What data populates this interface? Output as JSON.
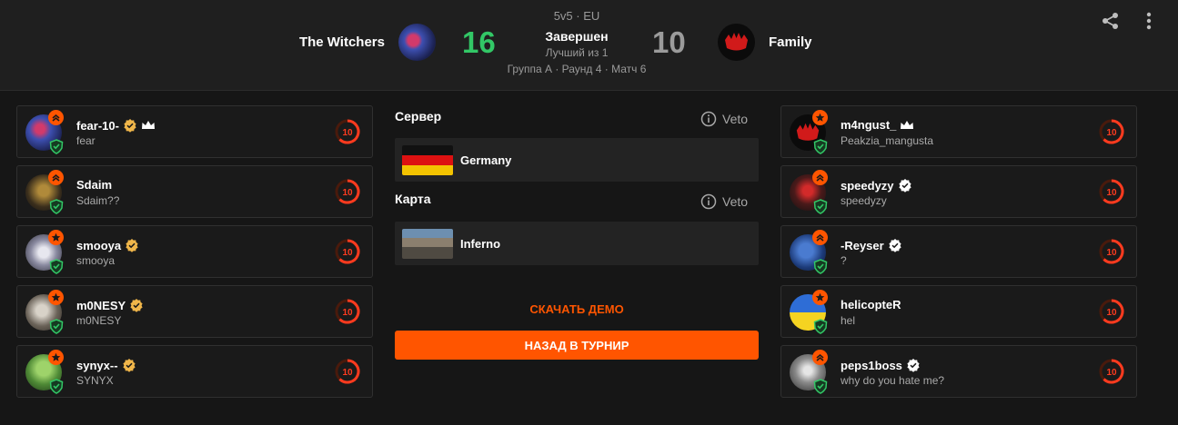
{
  "match": {
    "mode": "5v5 · EU",
    "status": "Завершен",
    "best_of": "Лучший из 1",
    "group_info": "Группа А · Раунд 4 · Матч 6"
  },
  "team_left": {
    "name": "The Witchers",
    "score": "16",
    "score_color": "#32c766"
  },
  "team_right": {
    "name": "Family",
    "score": "10",
    "score_color": "#9b9b9b"
  },
  "header_icons": [
    "share-icon",
    "more-vertical-icon"
  ],
  "left_players": [
    {
      "name": "fear-10-",
      "nick": "fear",
      "verified": true,
      "crown": true,
      "rank": "chevrons",
      "level": "10"
    },
    {
      "name": "Sdaim",
      "nick": "Sdaim??",
      "verified": false,
      "crown": false,
      "rank": "chevrons",
      "level": "10"
    },
    {
      "name": "smooya",
      "nick": "smooya",
      "verified": true,
      "crown": false,
      "rank": "star",
      "level": "10"
    },
    {
      "name": "m0NESY",
      "nick": "m0NESY",
      "verified": true,
      "crown": false,
      "rank": "star",
      "level": "10"
    },
    {
      "name": "synyx--",
      "nick": "SYNYX",
      "verified": true,
      "crown": false,
      "rank": "star",
      "level": "10"
    }
  ],
  "right_players": [
    {
      "name": "m4ngust_",
      "nick": "Peakzia_mangusta",
      "verified": false,
      "crown": true,
      "rank": "star",
      "level": "10"
    },
    {
      "name": "speedyzy",
      "nick": "speedyzy",
      "verified": true,
      "crown": false,
      "rank": "chevrons",
      "level": "10"
    },
    {
      "name": "-Reyser",
      "nick": "?",
      "verified": true,
      "crown": false,
      "rank": "chevrons",
      "level": "10"
    },
    {
      "name": "helicopteR",
      "nick": "hel",
      "verified": false,
      "crown": false,
      "rank": "star",
      "level": "10"
    },
    {
      "name": "peps1boss",
      "nick": "why do you hate me?",
      "verified": true,
      "crown": false,
      "rank": "chevrons",
      "level": "10"
    }
  ],
  "server": {
    "label": "Сервер",
    "veto_label": "Veto",
    "value": "Germany"
  },
  "map": {
    "label": "Карта",
    "veto_label": "Veto",
    "value": "Inferno"
  },
  "actions": {
    "download_demo": "СКАЧАТЬ ДЕМО",
    "back_to_tournament": "НАЗАД В ТУРНИР"
  },
  "colors": {
    "accent": "#ff5500",
    "win": "#32c766",
    "background": "#161616",
    "verified": "#f0b64a",
    "shield": "#32c766"
  }
}
